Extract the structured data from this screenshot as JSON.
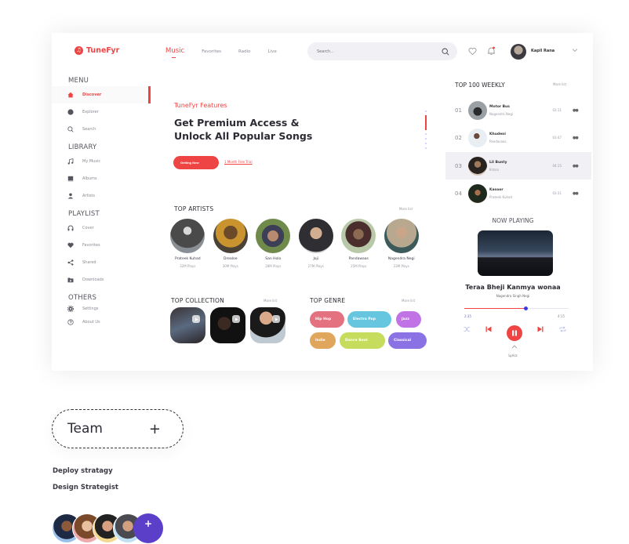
{
  "app": {
    "name": "TuneFyr",
    "accent": "#ef4444"
  },
  "nav": {
    "items": [
      {
        "label": "Music",
        "active": true
      },
      {
        "label": "Favorites",
        "active": false
      },
      {
        "label": "Radio",
        "active": false
      },
      {
        "label": "Live",
        "active": false
      }
    ]
  },
  "search": {
    "placeholder": "Search..."
  },
  "user": {
    "name": "Kapil Rana"
  },
  "sidebar": {
    "sections": [
      {
        "title": "MENU",
        "items": [
          {
            "label": "Discover",
            "icon": "home-icon",
            "active": true
          },
          {
            "label": "Explorer",
            "icon": "circle-icon",
            "active": false
          },
          {
            "label": "Search",
            "icon": "search-icon",
            "active": false
          }
        ]
      },
      {
        "title": "LIBRARY",
        "items": [
          {
            "label": "My Music",
            "icon": "music-note-icon"
          },
          {
            "label": "Albums",
            "icon": "album-icon"
          },
          {
            "label": "Artists",
            "icon": "person-icon"
          }
        ]
      },
      {
        "title": "PLAYLIST",
        "items": [
          {
            "label": "Cover",
            "icon": "headphones-icon"
          },
          {
            "label": "Favorites",
            "icon": "heart-icon"
          },
          {
            "label": "Shared",
            "icon": "share-icon"
          },
          {
            "label": "Downloads",
            "icon": "download-folder-icon"
          }
        ]
      },
      {
        "title": "OTHERS",
        "items": [
          {
            "label": "Settings",
            "icon": "gear-icon"
          },
          {
            "label": "About Us",
            "icon": "help-icon"
          }
        ]
      }
    ]
  },
  "hero": {
    "kicker": "TuneFyr Features",
    "title": "Get Premium Access & Unlock All Popular Songs",
    "primary_button": "Getting Now",
    "trial_link": "1 Month Free Trial",
    "slide_index": 2,
    "slide_count": 6
  },
  "top_artists": {
    "title": "TOP ARTISTS",
    "more": "More list",
    "items": [
      {
        "name": "Prateek Kuhad",
        "plays": "32M Plays"
      },
      {
        "name": "Drealoe",
        "plays": "30M Plays"
      },
      {
        "name": "San Holo",
        "plays": "28M Plays"
      },
      {
        "name": "Joji",
        "plays": "27M Plays"
      },
      {
        "name": "Pandawaas",
        "plays": "25M Plays"
      },
      {
        "name": "Nagendra Negi",
        "plays": "23M Plays"
      }
    ]
  },
  "top_collection": {
    "title": "TOP COLLECTION",
    "more": "More list"
  },
  "top_genre": {
    "title": "TOP GENRE",
    "more": "More list",
    "items": [
      {
        "label": "Hip Hop",
        "color": "#e4717f"
      },
      {
        "label": "Electro Pop",
        "color": "#66c6e0"
      },
      {
        "label": "Jazz",
        "color": "#c173e6"
      },
      {
        "label": "Indie",
        "color": "#e0a65c"
      },
      {
        "label": "Dance Beat",
        "color": "#c6dc5c"
      },
      {
        "label": "Classical",
        "color": "#8a72e4"
      }
    ]
  },
  "top100": {
    "title": "TOP 100 WEEKLY",
    "more": "More list",
    "tracks": [
      {
        "rank": "01",
        "title": "Motor Bus",
        "artist": "Nagendra Negi",
        "duration": "03:11"
      },
      {
        "rank": "02",
        "title": "Khudeni",
        "artist": "Pandavaas",
        "duration": "03:47"
      },
      {
        "rank": "03",
        "title": "Lil Bunty",
        "artist": "Kr$na",
        "duration": "04:15",
        "active": true
      },
      {
        "rank": "04",
        "title": "Kasoor",
        "artist": "Prateek Kuhad",
        "duration": "03:31"
      }
    ]
  },
  "now_playing": {
    "title": "NOW PLAYING",
    "song": "Teraa Bheji Kanmya wonaa",
    "artist": "Nagendra Singh Negi",
    "current": "2:35",
    "total": "4:15",
    "progress": 0.59,
    "lyrics": "Lyrics"
  },
  "team": {
    "label": "Team",
    "roles": [
      "Deploy stratagy",
      "Design Strategist"
    ],
    "add_label": "+"
  }
}
